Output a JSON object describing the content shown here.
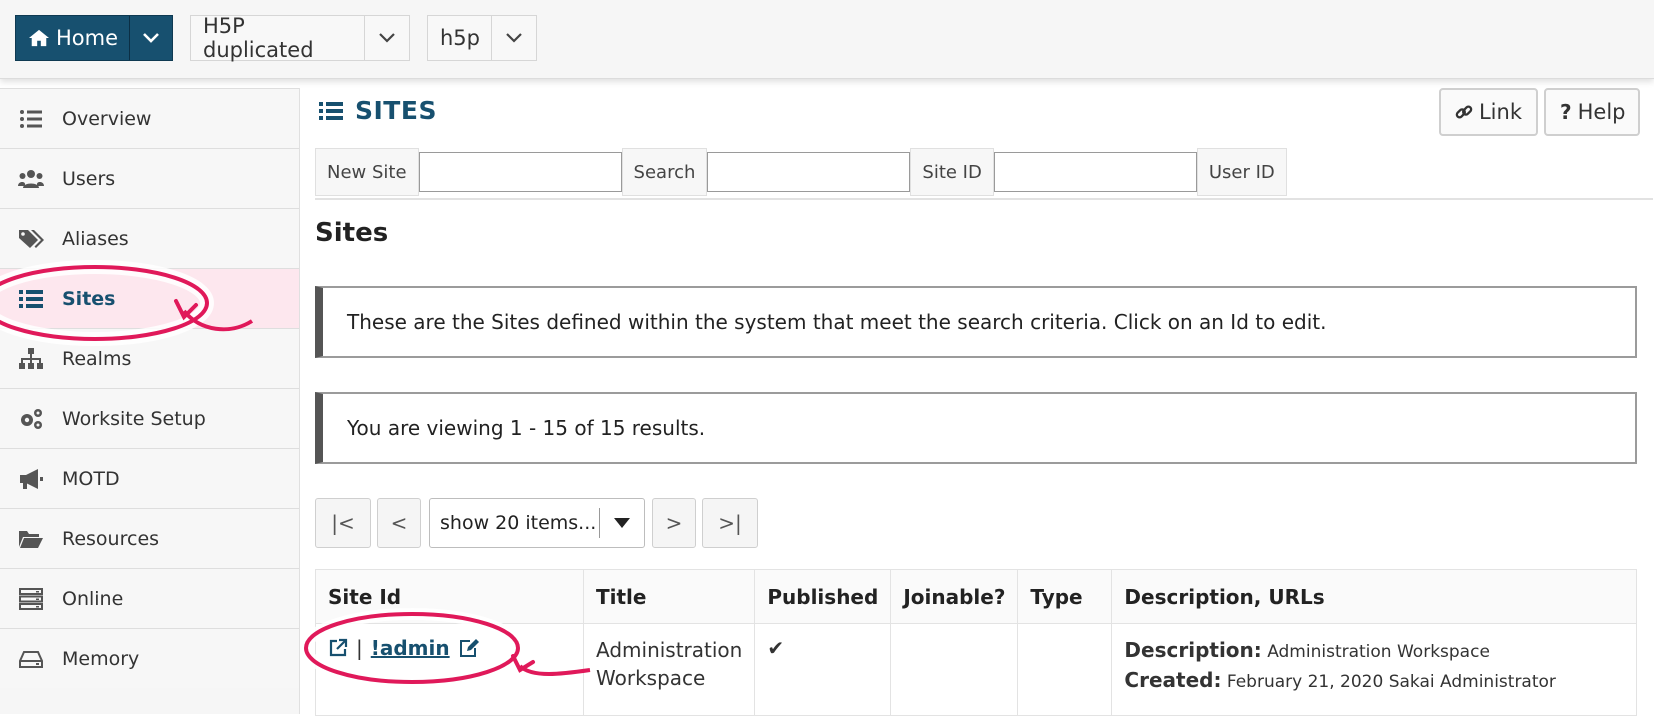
{
  "topbar": {
    "home_label": "Home",
    "site_select": "H5P duplicated",
    "tool_select": "h5p"
  },
  "sidebar": {
    "items": [
      {
        "label": "Overview",
        "icon": "list-icon"
      },
      {
        "label": "Users",
        "icon": "users-icon"
      },
      {
        "label": "Aliases",
        "icon": "tags-icon"
      },
      {
        "label": "Sites",
        "icon": "list-icon",
        "active": true
      },
      {
        "label": "Realms",
        "icon": "sitemap-icon"
      },
      {
        "label": "Worksite Setup",
        "icon": "gears-icon"
      },
      {
        "label": "MOTD",
        "icon": "megaphone-icon"
      },
      {
        "label": "Resources",
        "icon": "folder-open-icon"
      },
      {
        "label": "Online",
        "icon": "server-icon"
      },
      {
        "label": "Memory",
        "icon": "hdd-icon"
      }
    ]
  },
  "main": {
    "title": "SITES",
    "link_label": "Link",
    "help_label": "Help",
    "search": {
      "new_site_label": "New Site",
      "search_label": "Search",
      "site_id_label": "Site ID",
      "user_id_label": "User ID"
    },
    "heading": "Sites",
    "info_message": "These are the Sites defined within the system that meet the search criteria. Click on an Id to edit.",
    "results_message": "You are viewing 1 - 15 of 15 results.",
    "pager": {
      "first": "|<",
      "prev": "<",
      "page_size": "show 20 items...",
      "next": ">",
      "last": ">|"
    },
    "table": {
      "headers": [
        "Site Id",
        "Title",
        "Published",
        "Joinable?",
        "Type",
        "Description, URLs"
      ],
      "rows": [
        {
          "site_id": "!admin",
          "separator": "|",
          "title": "Administration Workspace",
          "published": "✔",
          "joinable": "",
          "type": "",
          "description_label": "Description:",
          "description": "Administration Workspace",
          "created_label": "Created:",
          "created": "February 21, 2020 Sakai Administrator"
        }
      ]
    }
  },
  "colors": {
    "brand": "#17506f",
    "annotation": "#e0195a",
    "active_bg": "#fde7ee"
  }
}
